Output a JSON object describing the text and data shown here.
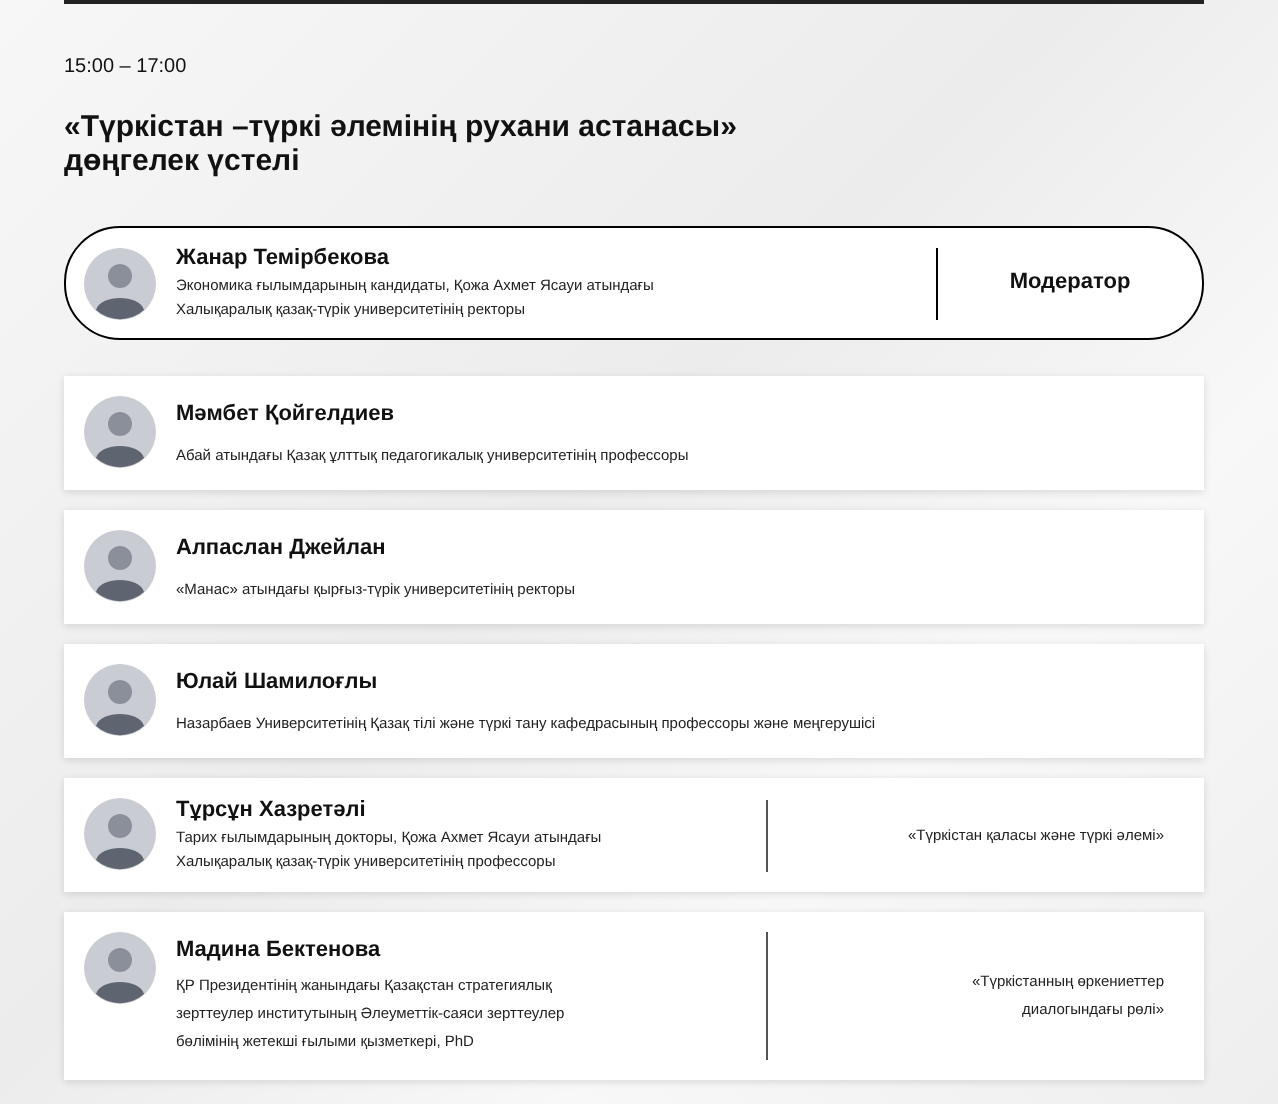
{
  "session": {
    "time": "15:00 – 17:00",
    "title_lines": [
      "«Түркістан –түркі әлемінің рухани астанасы»",
      "дөңгелек үстелі"
    ]
  },
  "participants": [
    {
      "kind": "moderator",
      "name": "Жанар Темірбекова",
      "description_lines": [
        "Экономика ғылымдарының кандидаты, Қожа Ахмет Ясауи атындағы",
        "Халықаралық қазақ-түрік университетінің ректоры"
      ],
      "role": "Модератор"
    },
    {
      "kind": "speaker",
      "name": "Мәмбет Қойгелдиев",
      "description_lines": [
        "Абай атындағы Қазақ ұлттық педагогикалық университетінің профессоры"
      ]
    },
    {
      "kind": "speaker",
      "name": "Алпаслан Джейлан",
      "description_lines": [
        "«Манас» атындағы қырғыз-түрік университетінің ректоры"
      ]
    },
    {
      "kind": "speaker",
      "name": "Юлай Шамилоғлы",
      "description_lines": [
        "Назарбаев Университетінің Қазақ тілі және түркі тану кафедрасының профессоры және меңгерушісі"
      ]
    },
    {
      "kind": "speaker",
      "name": "Тұрсұн Хазретәлі",
      "description_lines": [
        "Тарих ғылымдарының докторы, Қожа Ахмет Ясауи атындағы",
        "Халықаралық қазақ-түрік университетінің профессоры"
      ],
      "topic_lines": [
        "«Түркістан қаласы және түркі әлемі»"
      ]
    },
    {
      "kind": "speaker",
      "name": "Мадина Бектенова",
      "description_lines": [
        "ҚР Президентінің жанындағы Қазақстан стратегиялық",
        "зерттеулер институтының Әлеуметтік-саяси зерттеулер",
        "бөлімінің жетекші ғылыми қызметкері, PhD"
      ],
      "topic_lines": [
        "«Түркістанның өркениеттер",
        "диалогындағы рөлі»"
      ]
    }
  ]
}
